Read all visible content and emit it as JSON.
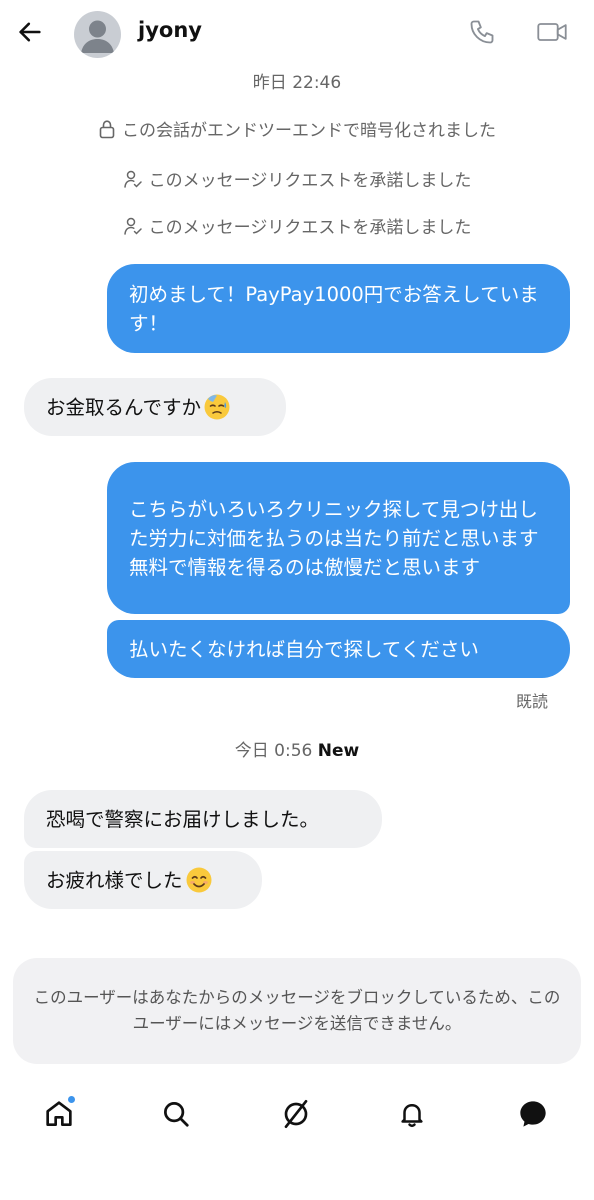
{
  "header": {
    "username": "jyony",
    "back_icon": "arrow-left-icon",
    "phone_icon": "phone-icon",
    "video_icon": "video-camera-icon"
  },
  "timestamps": {
    "yesterday": "昨日 22:46",
    "today": "今日 0:56",
    "new_label": "New"
  },
  "system_messages": [
    {
      "icon": "lock-icon",
      "text": "この会話がエンドツーエンドで暗号化されました"
    },
    {
      "icon": "person-check-icon",
      "text": "このメッセージリクエストを承諾しました"
    },
    {
      "icon": "person-check-icon",
      "text": "このメッセージリクエストを承諾しました"
    }
  ],
  "messages": [
    {
      "direction": "outgoing",
      "text": "初めまして！PayPay1000円でお答えしています！"
    },
    {
      "direction": "incoming",
      "text": "お金取るんですか",
      "emoji": "sweat-face-emoji"
    },
    {
      "direction": "outgoing",
      "text": "こちらがいろいろクリニック探して見つけ出した労力に対価を払うのは当たり前だと思います\n無料で情報を得るのは傲慢だと思います"
    },
    {
      "direction": "outgoing",
      "text": "払いたくなければ自分で探してください"
    },
    {
      "direction": "incoming",
      "text": "恐喝で警察にお届けしました。"
    },
    {
      "direction": "incoming",
      "text": "お疲れ様でした",
      "emoji": "smiling-face-emoji"
    }
  ],
  "read_receipt": "既読",
  "blocked_notice": "このユーザーはあなたからのメッセージをブロックしているため、このユーザーにはメッセージを送信できません。",
  "nav": {
    "items": [
      "home-icon",
      "search-icon",
      "explore-icon",
      "bell-icon",
      "messages-icon"
    ],
    "active": "messages-icon",
    "home_has_dot": true
  },
  "colors": {
    "outgoing_bubble": "#3c94ec",
    "incoming_bubble": "#eff0f2",
    "accent": "#3c94ec"
  }
}
